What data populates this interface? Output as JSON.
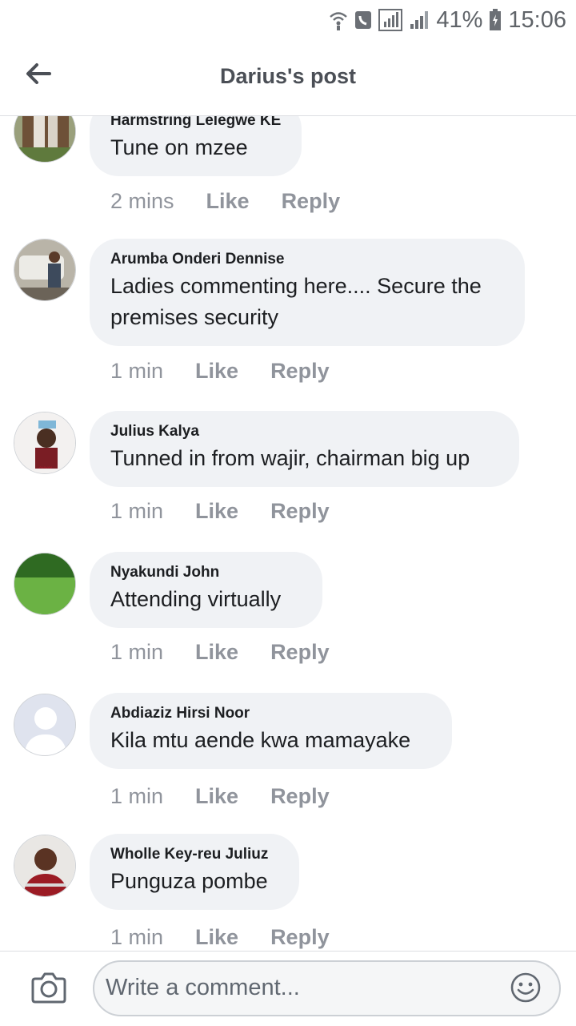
{
  "status_bar": {
    "battery": "41%",
    "time": "15:06"
  },
  "header": {
    "title": "Darius's post"
  },
  "comments": [
    {
      "name": "Harmstring Lelegwe KE",
      "text": "Tune on mzee",
      "time": "2 mins",
      "like": "Like",
      "reply": "Reply"
    },
    {
      "name": "Arumba Onderi Dennise",
      "text_line1": "Ladies commenting here.... Secure the",
      "text_line2": "premises security",
      "time": "1 min",
      "like": "Like",
      "reply": "Reply"
    },
    {
      "name": "Julius Kalya",
      "text": "Tunned in from wajir, chairman big up",
      "time": "1 min",
      "like": "Like",
      "reply": "Reply"
    },
    {
      "name": "Nyakundi John",
      "text": "Attending virtually",
      "time": "1 min",
      "like": "Like",
      "reply": "Reply"
    },
    {
      "name": "Abdiaziz Hirsi Noor",
      "text": "Kila mtu aende kwa mamayake",
      "time": "1 min",
      "like": "Like",
      "reply": "Reply"
    },
    {
      "name": "Wholle Key-reu Juliuz",
      "text": "Punguza pombe",
      "time": "1 min",
      "like": "Like",
      "reply": "Reply"
    }
  ],
  "composer": {
    "placeholder": "Write a comment..."
  }
}
